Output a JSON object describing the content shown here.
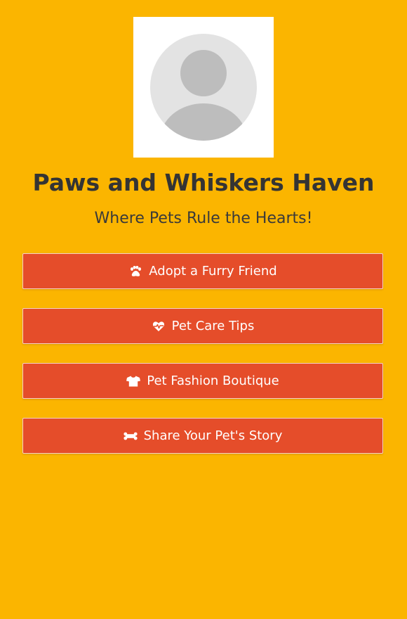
{
  "profile": {
    "avatar_icon": "default-user-avatar"
  },
  "header": {
    "title": "Paws and Whiskers Haven",
    "subtitle": "Where Pets Rule the Hearts!"
  },
  "links": [
    {
      "label": "Adopt a Furry Friend",
      "icon": "paw-icon"
    },
    {
      "label": "Pet Care Tips",
      "icon": "heartbeat-icon"
    },
    {
      "label": "Pet Fashion Boutique",
      "icon": "shirt-icon"
    },
    {
      "label": "Share Your Pet's Story",
      "icon": "bone-icon"
    }
  ],
  "colors": {
    "background": "#FBB500",
    "button": "#E54D2A",
    "title_text": "#343434",
    "button_text": "#FFFFFF"
  }
}
